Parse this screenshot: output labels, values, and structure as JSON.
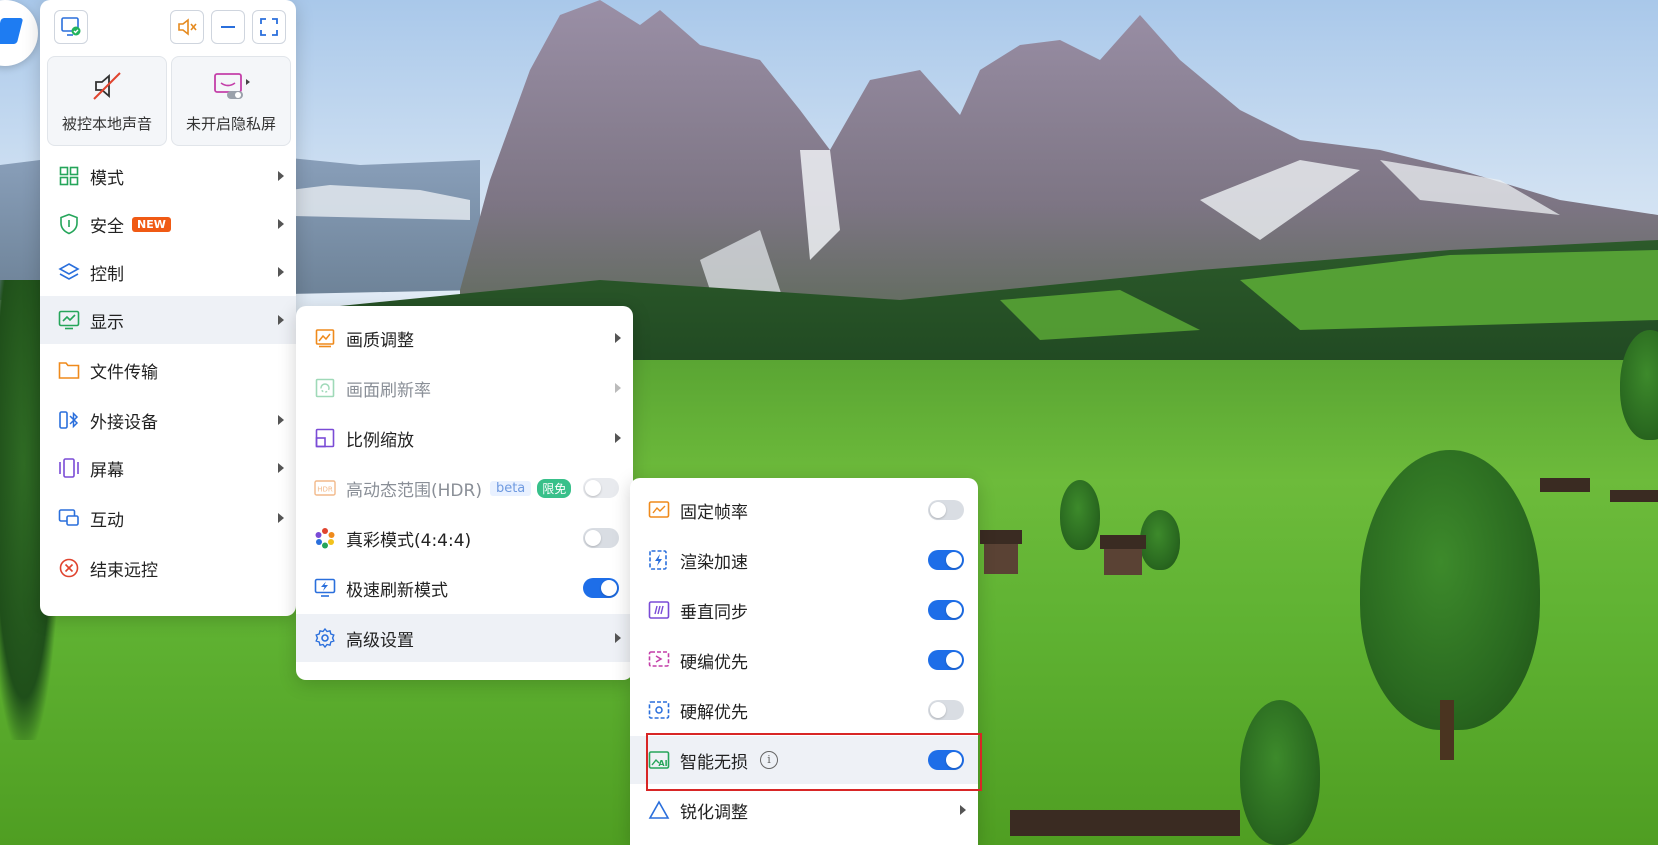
{
  "toolbar": {
    "monitor_icon": "monitor-check-icon",
    "mute_icon": "speaker-muted-icon",
    "minimize_icon": "minimize-icon",
    "fullscreen_icon": "fullscreen-icon"
  },
  "quick_actions": [
    {
      "label": "被控本地声音",
      "icon": "speaker-slash-icon"
    },
    {
      "label": "未开启隐私屏",
      "icon": "privacy-screen-icon"
    }
  ],
  "main_menu": [
    {
      "label": "模式",
      "icon": "grid-icon",
      "has_submenu": true
    },
    {
      "label": "安全",
      "icon": "shield-icon",
      "badge": "NEW",
      "has_submenu": true
    },
    {
      "label": "控制",
      "icon": "layers-icon",
      "has_submenu": true
    },
    {
      "label": "显示",
      "icon": "display-chart-icon",
      "has_submenu": true,
      "active": true
    },
    {
      "label": "文件传输",
      "icon": "folder-icon",
      "has_submenu": false
    },
    {
      "label": "外接设备",
      "icon": "bluetooth-device-icon",
      "has_submenu": true
    },
    {
      "label": "屏幕",
      "icon": "screens-icon",
      "has_submenu": true
    },
    {
      "label": "互动",
      "icon": "chat-screen-icon",
      "has_submenu": true
    },
    {
      "label": "结束远控",
      "icon": "close-circle-icon",
      "has_submenu": false
    }
  ],
  "display_submenu": [
    {
      "label": "画质调整",
      "icon": "image-quality-icon",
      "control": "arrow"
    },
    {
      "label": "画面刷新率",
      "icon": "refresh-rate-icon",
      "control": "arrow",
      "disabled": true
    },
    {
      "label": "比例缩放",
      "icon": "scale-icon",
      "control": "arrow"
    },
    {
      "label": "高动态范围(HDR)",
      "icon": "hdr-icon",
      "badge_beta": "beta",
      "badge_free": "限免",
      "control": "toggle",
      "on": false,
      "disabled": true
    },
    {
      "label": "真彩模式(4:4:4)",
      "icon": "color-wheel-icon",
      "control": "toggle",
      "on": false
    },
    {
      "label": "极速刷新模式",
      "icon": "fast-refresh-icon",
      "control": "toggle",
      "on": true
    },
    {
      "label": "高级设置",
      "icon": "gear-icon",
      "control": "arrow",
      "active": true
    }
  ],
  "advanced_submenu": [
    {
      "label": "固定帧率",
      "icon": "fixed-fps-icon",
      "control": "toggle",
      "on": false
    },
    {
      "label": "渲染加速",
      "icon": "render-accel-icon",
      "control": "toggle",
      "on": true
    },
    {
      "label": "垂直同步",
      "icon": "vsync-icon",
      "control": "toggle",
      "on": true
    },
    {
      "label": "硬编优先",
      "icon": "hw-encode-icon",
      "control": "toggle",
      "on": true
    },
    {
      "label": "硬解优先",
      "icon": "hw-decode-icon",
      "control": "toggle",
      "on": false
    },
    {
      "label": "智能无损",
      "icon": "ai-image-icon",
      "control": "toggle",
      "on": true,
      "info": "i",
      "highlighted": true
    },
    {
      "label": "锐化调整",
      "icon": "triangle-icon",
      "control": "arrow"
    }
  ],
  "colors": {
    "accent": "#1e6ee8",
    "new_badge": "#f05a14",
    "free_badge": "#38c08a",
    "highlight_border": "#d82626"
  }
}
